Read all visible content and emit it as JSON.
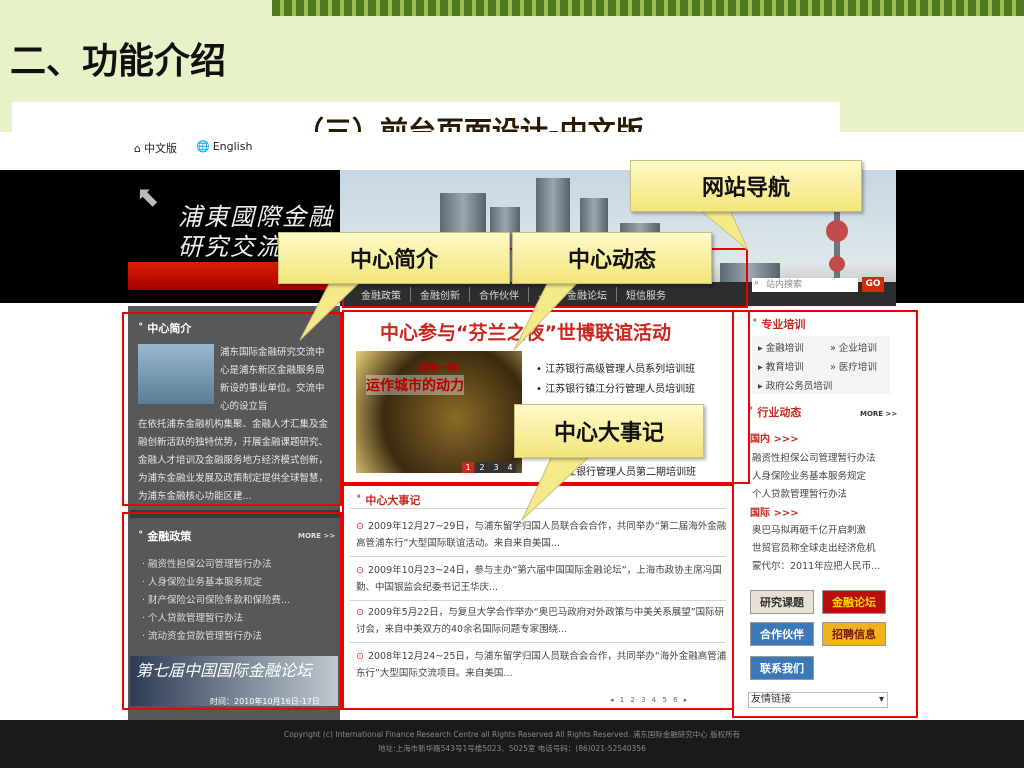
{
  "slide": {
    "title": "二、功能介绍",
    "subtitle": "（三）前台页面设计-中文版"
  },
  "lang": {
    "cn": "中文版",
    "en": "English"
  },
  "logo": {
    "line1": "浦東國際金融",
    "line2": "研究交流"
  },
  "nav": {
    "items": [
      "金融政策",
      "金融创新",
      "合作伙伴",
      "…",
      "金融论坛",
      "短信服务"
    ]
  },
  "search": {
    "placeholder": "站内搜索",
    "go": "GO"
  },
  "left": {
    "intro_title": "中心简介",
    "intro_text_lead": "浦东国际金融研究交流中心是浦东新区金融服务局新设的事业单位。交流中心的设立旨",
    "intro_text_rest": "在依托浦东金融机构集聚、金融人才汇集及金融创新活跃的独特优势，开展金融课题研究、金融人才培训及金融服务地方经济模式创新，为浦东金融业发展及政策制定提供全球智慧，为浦东金融核心功能区建...",
    "policy_title": "金融政策",
    "more": "MORE >>",
    "policy_items": [
      "· 融资性担保公司管理暂行办法",
      "· 人身保险业务基本服务规定",
      "· 财产保险公司保险条款和保险费...",
      "· 个人贷款管理暂行办法",
      "· 流动资金贷款管理暂行办法"
    ],
    "conf_title": "第七届中国国际金融论坛",
    "conf_date": "时间：2010年10月16日-17日"
  },
  "center": {
    "headline": "中心参与“芬兰之夜”世博联谊活动",
    "img_text1": "给你一种",
    "img_text2": "运作城市的动力",
    "pager": [
      "1",
      "2",
      "3",
      "4"
    ],
    "news": [
      "• 江苏银行高级管理人员系列培训班",
      "• 江苏银行镇江分行管理人员培训班",
      "商业银行管理人员第二期培训班"
    ],
    "events_title": "中心大事记",
    "events": [
      "2009年12月27~29日，与浦东留学归国人员联合会合作，共同举办“第二届海外金融高管浦东行”大型国际联谊活动。来自来自美国...",
      "2009年10月23~24日，参与主办“第六届中国国际金融论坛”，上海市政协主席冯国勤、中国银监会纪委书记王华庆...",
      "2009年5月22日，与复旦大学合作举办“奥巴马政府对外政策与中美关系展望”国际研讨会，来自中美双方的40余名国际问题专家围绕...",
      "2008年12月24~25日，与浦东留学归国人员联合会合作，共同举办“海外金融高管浦东行”大型国际交流项目。来自美国..."
    ],
    "pagination": "◂ 1 2 3 4 5 6 ▸"
  },
  "right": {
    "training_title": "专业培训",
    "training": [
      "金融培训",
      "企业培训",
      "教育培训",
      "医疗培训",
      "政府公务员培训"
    ],
    "industry_title": "行业动态",
    "domestic": "国内 >>>",
    "domestic_items": [
      "融资性担保公司管理暂行办法",
      "人身保险业务基本服务规定",
      "个人贷款管理暂行办法"
    ],
    "intl": "国际 >>>",
    "intl_items": [
      "奥巴马拟再砸千亿开启刺激",
      "世贸官员称全球走出经济危机",
      "蒙代尔：2011年应把人民币..."
    ],
    "buttons": [
      "研究课题",
      "金融论坛",
      "合作伙伴",
      "招聘信息",
      "联系我们"
    ],
    "friend_links": "友情链接"
  },
  "footer": {
    "line1": "Copyright (c) International Finance Research Centre all Rights Reserved All Rights Reserved. 浦东国际金融研究中心 版权所有",
    "line2": "地址:上海市新华路543号1号楼5023、5025室  电话号码：(86)021-52540356"
  },
  "callouts": {
    "nav": "网站导航",
    "intro": "中心简介",
    "news": "中心动态",
    "events": "中心大事记"
  }
}
